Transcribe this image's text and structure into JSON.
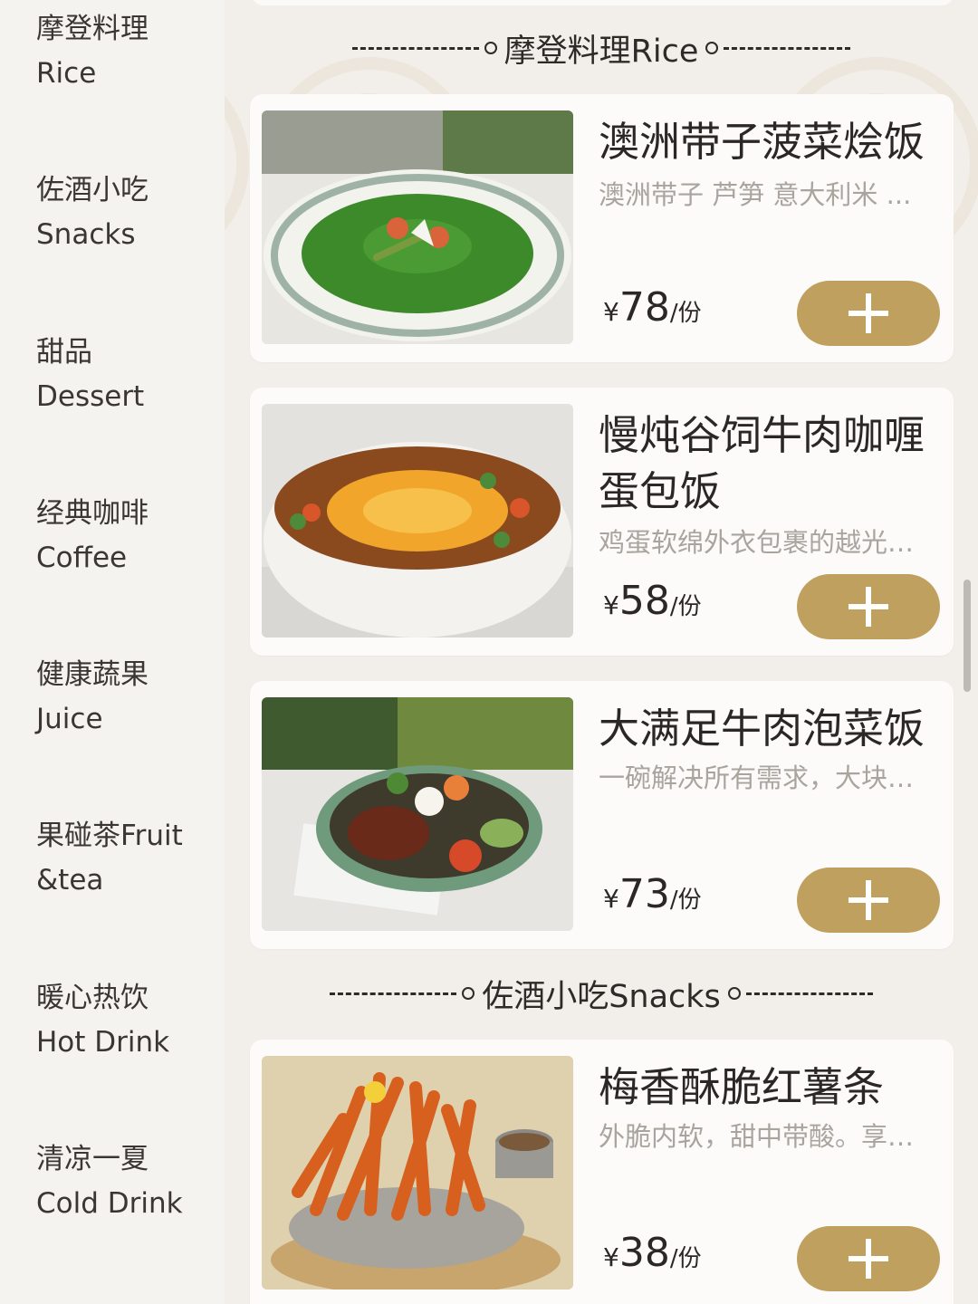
{
  "sidebar": {
    "categories": [
      {
        "zh": "摩登料理",
        "en": "Rice"
      },
      {
        "zh": "佐酒小吃",
        "en": "Snacks"
      },
      {
        "zh": "甜品",
        "en": "Dessert"
      },
      {
        "zh": "经典咖啡",
        "en": "Coffee"
      },
      {
        "zh": "健康蔬果",
        "en": "Juice"
      },
      {
        "zh": "果碰茶Fruit",
        "en": "&tea"
      },
      {
        "zh": "暖心热饮",
        "en": "Hot Drink"
      },
      {
        "zh": "清凉一夏",
        "en": "Cold Drink"
      }
    ]
  },
  "sections": {
    "rice": {
      "title": "摩登料理Rice"
    },
    "snacks": {
      "title": "佐酒小吃Snacks"
    }
  },
  "dishes": [
    {
      "name": "澳洲带子菠菜烩饭",
      "desc": "澳洲带子 芦笋 意大利米 ...",
      "yen": "¥",
      "price": "78",
      "unit": "/份"
    },
    {
      "name": "慢炖谷饲牛肉咖喱蛋包饭",
      "desc": "鸡蛋软绵外衣包裹的越光…",
      "yen": "¥",
      "price": "58",
      "unit": "/份"
    },
    {
      "name": "大满足牛肉泡菜饭",
      "desc": "一碗解决所有需求，大块…",
      "yen": "¥",
      "price": "73",
      "unit": "/份"
    },
    {
      "name": "梅香酥脆红薯条",
      "desc": "外脆内软，甜中带酸。享…",
      "yen": "¥",
      "price": "38",
      "unit": "/份"
    }
  ],
  "colors": {
    "accent": "#bfa05e",
    "text": "#2a2724",
    "muted": "#a9a49e",
    "card": "#fcfbf9",
    "background": "#f2efeb"
  },
  "icons": {
    "add": "plus-icon"
  }
}
